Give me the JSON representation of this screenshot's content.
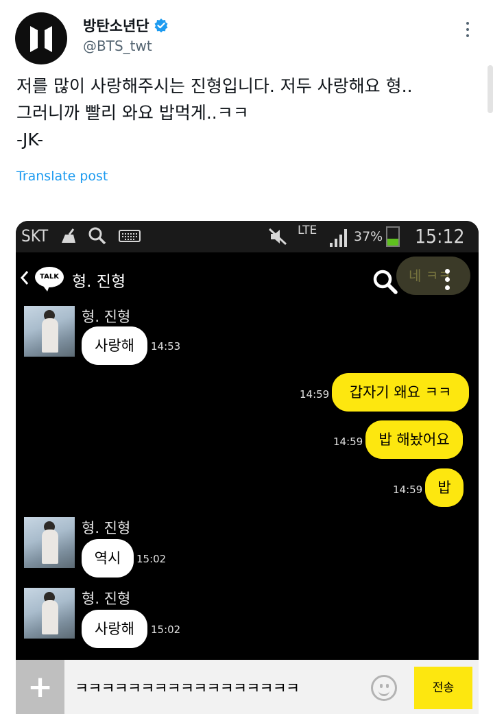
{
  "tweet": {
    "display_name": "방탄소년단",
    "verified": true,
    "handle": "@BTS_twt",
    "text": "저를 많이 사랑해주시는 진형입니다. 저두 사랑해요 형..\n그러니까 빨리 와요 밥먹게..ㅋㅋ\n-JK-",
    "translate_label": "Translate post"
  },
  "screenshot": {
    "status_bar": {
      "carrier": "SKT",
      "network": "LTE",
      "battery": "37%",
      "battery_level": 0.37,
      "time": "15:12"
    },
    "chat_header": {
      "back_icon": "chevron-left-icon",
      "logo_text": "TALK",
      "title": "형. 진형",
      "overlay_bubble": "네 ㅋㅋ"
    },
    "messages": [
      {
        "side": "left",
        "sender": "형. 진형",
        "text": "사랑해",
        "time": "14:53"
      },
      {
        "side": "right",
        "text": "갑자기 왜요 ㅋㅋ",
        "time": "14:59"
      },
      {
        "side": "right",
        "text": "밥 해놨어요",
        "time": "14:59"
      },
      {
        "side": "right",
        "text": "밥",
        "time": "14:59"
      },
      {
        "side": "left",
        "sender": "형. 진형",
        "text": "역시",
        "time": "15:02"
      },
      {
        "side": "left",
        "sender": "형. 진형",
        "text": "사랑해",
        "time": "15:02"
      }
    ],
    "input_bar": {
      "text": "ㅋㅋㅋㅋㅋㅋㅋㅋㅋㅋㅋㅋㅋㅋㅋㅋㅋ",
      "send_label": "전송"
    }
  },
  "colors": {
    "link_blue": "#1d9bf0",
    "kakao_yellow": "#fde70f",
    "verified_blue": "#1d9bf0"
  }
}
